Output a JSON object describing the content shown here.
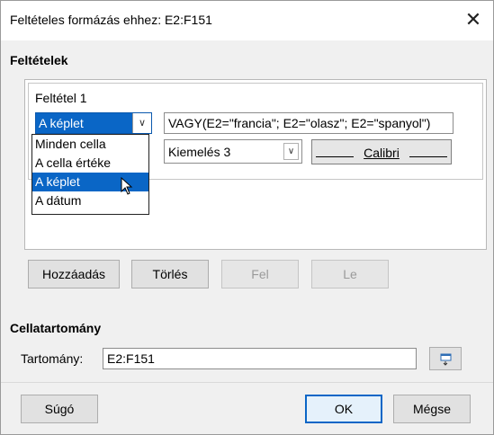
{
  "window": {
    "title": "Feltételes formázás ehhez: E2:F151",
    "close_icon": "close-icon"
  },
  "conditions": {
    "heading": "Feltételek",
    "condition_title": "Feltétel 1",
    "type_selected": "A képlet",
    "formula": "VAGY(E2=\"francia\"; E2=\"olasz\"; E2=\"spanyol\")",
    "style_selected": "Kiemelés 3",
    "preview_text": "Calibri",
    "dropdown_options": [
      "Minden cella",
      "A cella értéke",
      "A képlet",
      "A dátum"
    ],
    "dropdown_selected_index": 2
  },
  "buttons": {
    "add": "Hozzáadás",
    "delete": "Törlés",
    "up": "Fel",
    "down": "Le",
    "help": "Súgó",
    "ok": "OK",
    "cancel": "Mégse"
  },
  "range": {
    "heading": "Cellatartomány",
    "label": "Tartomány:",
    "value": "E2:F151"
  },
  "colors": {
    "accent": "#0a66c6",
    "dialog_bg": "#f0f0f0"
  }
}
